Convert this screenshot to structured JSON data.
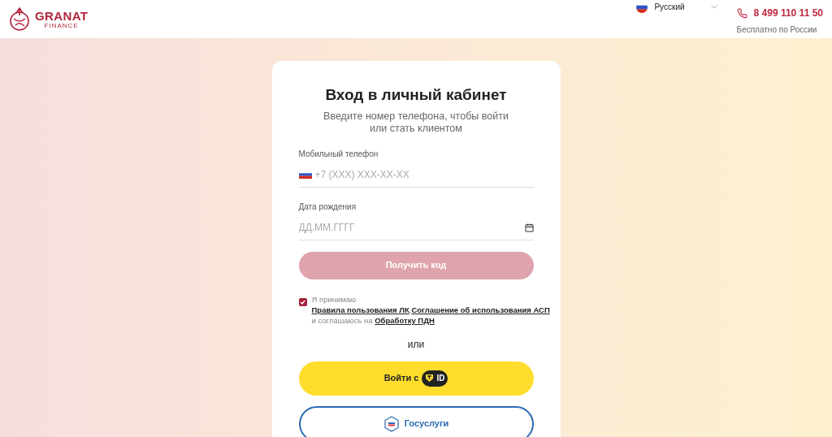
{
  "header": {
    "logo": {
      "name": "GRANAT",
      "subtitle": "FINANCE"
    },
    "language": "Русский",
    "phone": "8 499 110 11 50",
    "phone_note": "Бесплатно по России"
  },
  "card": {
    "title": "Вход в личный кабинет",
    "subtitle": "Введите номер телефона, чтобы войти или стать клиентом",
    "phone_field": {
      "label": "Мобильный телефон",
      "placeholder": "+7 (XXX) XXX-XX-XX"
    },
    "date_field": {
      "label": "Дата рождения",
      "placeholder": "ДД.ММ.ГГГГ"
    },
    "submit": {
      "label": "Получить код",
      "disabled": true
    },
    "consent": {
      "checked": true,
      "parts": [
        {
          "kind": "plain",
          "text": "Я принимаю"
        },
        {
          "kind": "link",
          "text": "Правила пользования ЛК"
        },
        {
          "kind": "plain",
          "text": ","
        },
        {
          "kind": "link",
          "text": "Соглашение об использования АСП"
        },
        {
          "kind": "plain",
          "text": "и соглашаюсь на"
        },
        {
          "kind": "link",
          "text": "Обработку ПДН"
        }
      ]
    },
    "separator": "или",
    "tid_button": {
      "label": "Войти с",
      "badge": "ID"
    },
    "gos_button": {
      "label": "Госуслуги"
    }
  }
}
